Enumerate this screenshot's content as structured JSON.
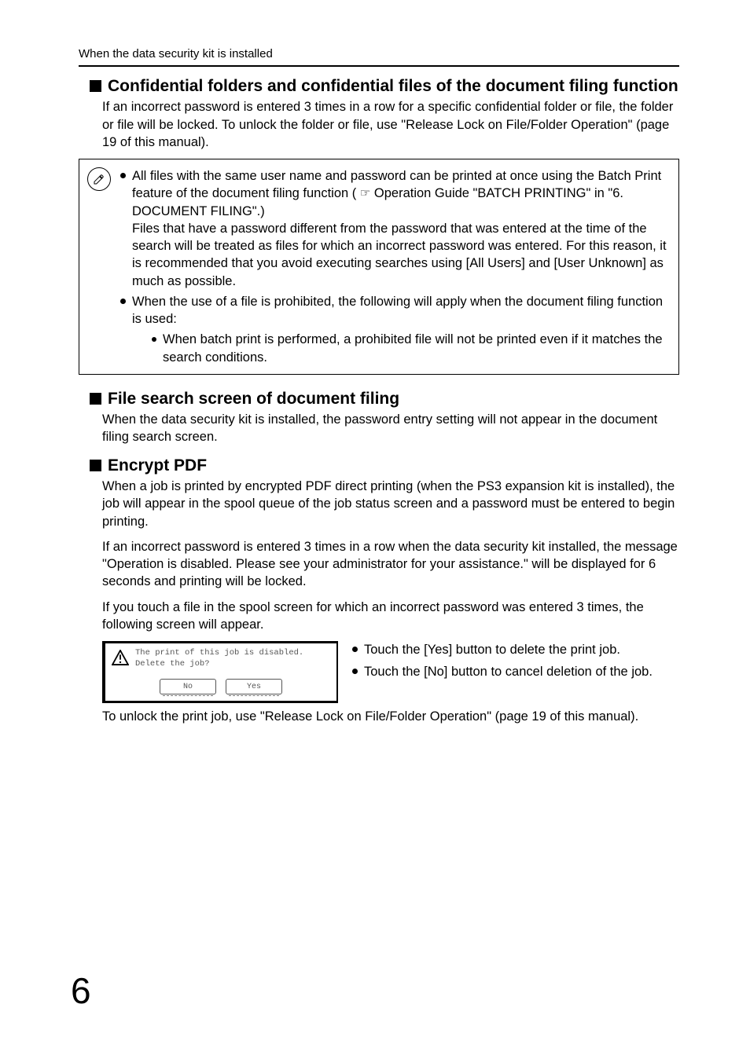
{
  "running_header": "When the data security kit is installed",
  "section1": {
    "title": "Confidential folders and confidential files of the document filing function",
    "body": "If an incorrect password is entered 3 times in a row for a specific confidential folder or file, the folder or file will be locked. To unlock the folder or file, use \"Release Lock on File/Folder Operation\" (page 19 of this manual)."
  },
  "notebox": {
    "bullet1_part1": "All files with the same user name and password can be printed at once using the Batch Print feature of the document filing function ( ",
    "bullet1_part2": " Operation Guide \"BATCH PRINTING\" in \"6. DOCUMENT FILING\".)",
    "bullet1_para2": "Files that have a password different from the password that was entered at the time of the search will be treated as files for which an incorrect password was entered. For this reason, it is recommended that you avoid executing searches using [All Users] and [User Unknown] as much as possible.",
    "bullet2": "When the use of a file is prohibited, the following will apply when the document filing function is used:",
    "sub_bullet": "When batch print is performed, a prohibited file will not be printed even if it matches the search conditions."
  },
  "section2": {
    "title": "File search screen of document filing",
    "body": "When the data security kit is installed, the password entry setting will not appear in the document filing search screen."
  },
  "section3": {
    "title": "Encrypt PDF",
    "para1": "When a job is printed by encrypted PDF direct printing (when the PS3 expansion kit is installed), the job will appear in the spool queue of the job status screen and a password must be entered to begin printing.",
    "para2": "If an incorrect password is entered 3 times in a row when the data security kit installed, the message \"Operation is disabled. Please see your administrator for your assistance.\" will be displayed for 6 seconds and printing will be locked.",
    "para3": "If you touch a file in the spool screen for which an incorrect password was entered 3 times, the following screen will appear."
  },
  "dialog": {
    "line1": "The print of this job is disabled.",
    "line2": "Delete the job?",
    "btn_no": "No",
    "btn_yes": "Yes"
  },
  "right_bullets": {
    "b1": "Touch the [Yes] button to delete the print job.",
    "b2": "Touch the [No] button to cancel deletion of the job."
  },
  "unlock_line": "To unlock the print job, use \"Release Lock on File/Folder Operation\" (page 19 of this manual).",
  "page_number": "6"
}
